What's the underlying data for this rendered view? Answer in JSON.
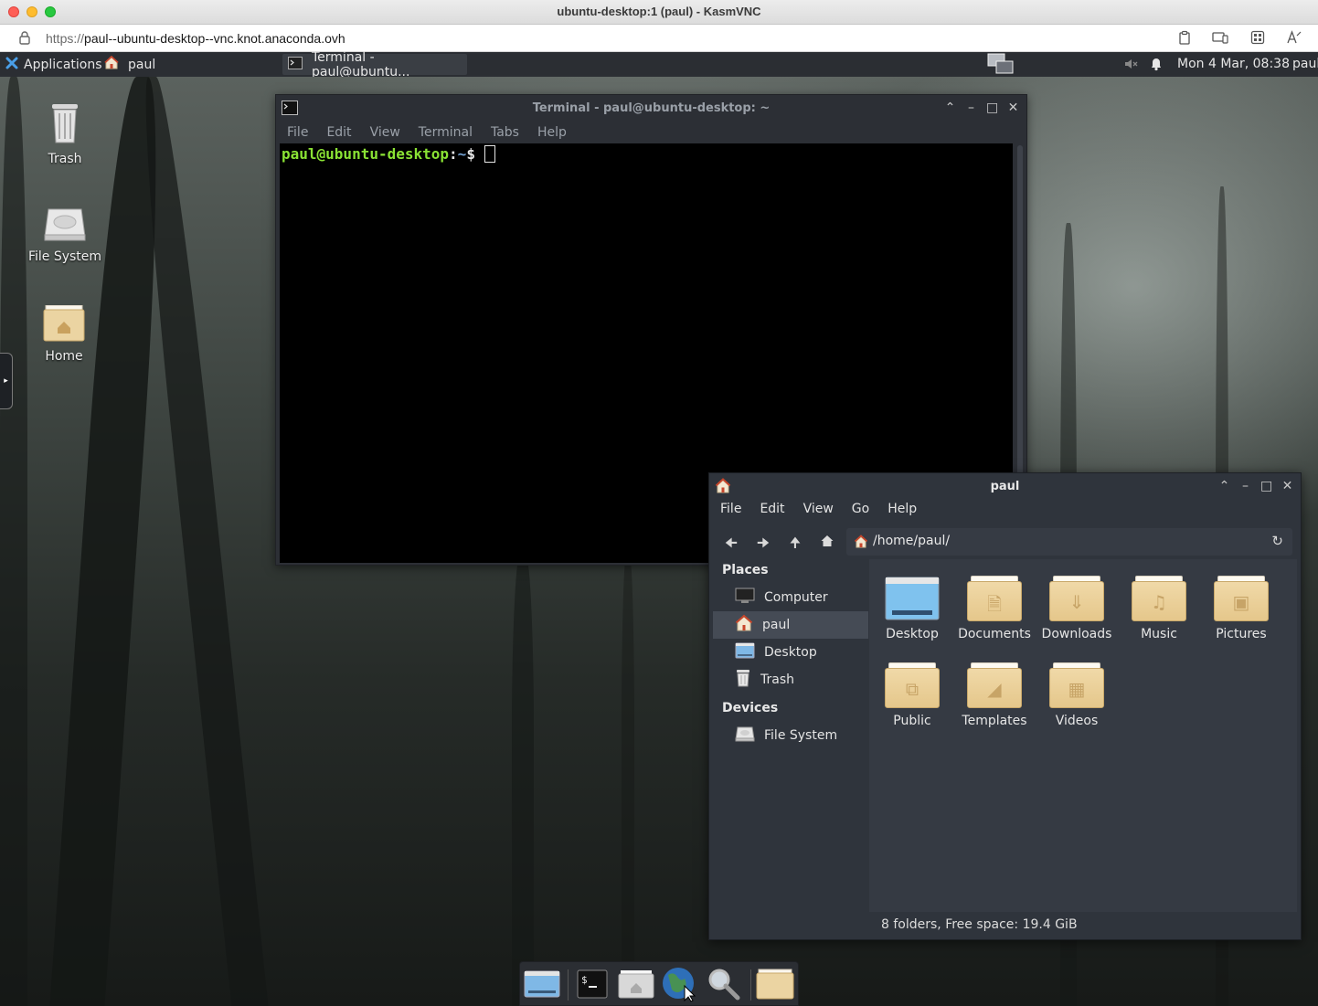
{
  "mac_window": {
    "title": "ubuntu-desktop:1 (paul) - KasmVNC",
    "url_protocol": "https://",
    "url_rest": "paul--ubuntu-desktop--vnc.knot.anaconda.ovh"
  },
  "panel": {
    "applications_label": "Applications",
    "home_task_label": "paul",
    "terminal_task_label": "Terminal - paul@ubuntu...",
    "datetime": "Mon  4 Mar, 08:38",
    "user": "paul"
  },
  "desktop_icons": [
    {
      "label": "Trash",
      "icon": "trash-icon"
    },
    {
      "label": "File System",
      "icon": "drive-icon"
    },
    {
      "label": "Home",
      "icon": "home-folder-icon"
    }
  ],
  "terminal": {
    "title": "Terminal - paul@ubuntu-desktop: ~",
    "menu": [
      "File",
      "Edit",
      "View",
      "Terminal",
      "Tabs",
      "Help"
    ],
    "prompt_user": "paul@ubuntu-desktop",
    "prompt_sep": ":",
    "prompt_path": "~",
    "prompt_symbol": "$ ",
    "colors": {
      "prompt_user": "#8ae234",
      "prompt_path": "#729fcf",
      "background": "#000000"
    }
  },
  "file_manager": {
    "title": "paul",
    "menu": [
      "File",
      "Edit",
      "View",
      "Go",
      "Help"
    ],
    "path": "/home/paul/",
    "places_heading": "Places",
    "places": [
      {
        "label": "Computer",
        "icon": "computer-icon",
        "active": false
      },
      {
        "label": "paul",
        "icon": "home-icon",
        "active": true
      },
      {
        "label": "Desktop",
        "icon": "desktop-icon",
        "active": false
      },
      {
        "label": "Trash",
        "icon": "trash-icon",
        "active": false
      }
    ],
    "devices_heading": "Devices",
    "devices": [
      {
        "label": "File System",
        "icon": "drive-icon"
      }
    ],
    "folders": [
      {
        "label": "Desktop",
        "icon": "desktop-folder-icon"
      },
      {
        "label": "Documents",
        "icon": "documents-folder-icon"
      },
      {
        "label": "Downloads",
        "icon": "downloads-folder-icon"
      },
      {
        "label": "Music",
        "icon": "music-folder-icon"
      },
      {
        "label": "Pictures",
        "icon": "pictures-folder-icon"
      },
      {
        "label": "Public",
        "icon": "public-folder-icon"
      },
      {
        "label": "Templates",
        "icon": "templates-folder-icon"
      },
      {
        "label": "Videos",
        "icon": "videos-folder-icon"
      }
    ],
    "status": "8 folders, Free space: 19.4 GiB"
  },
  "dock": [
    "desktop-icon",
    "terminal-icon",
    "home-folder-icon",
    "web-browser-icon",
    "search-icon",
    "folder-icon"
  ]
}
